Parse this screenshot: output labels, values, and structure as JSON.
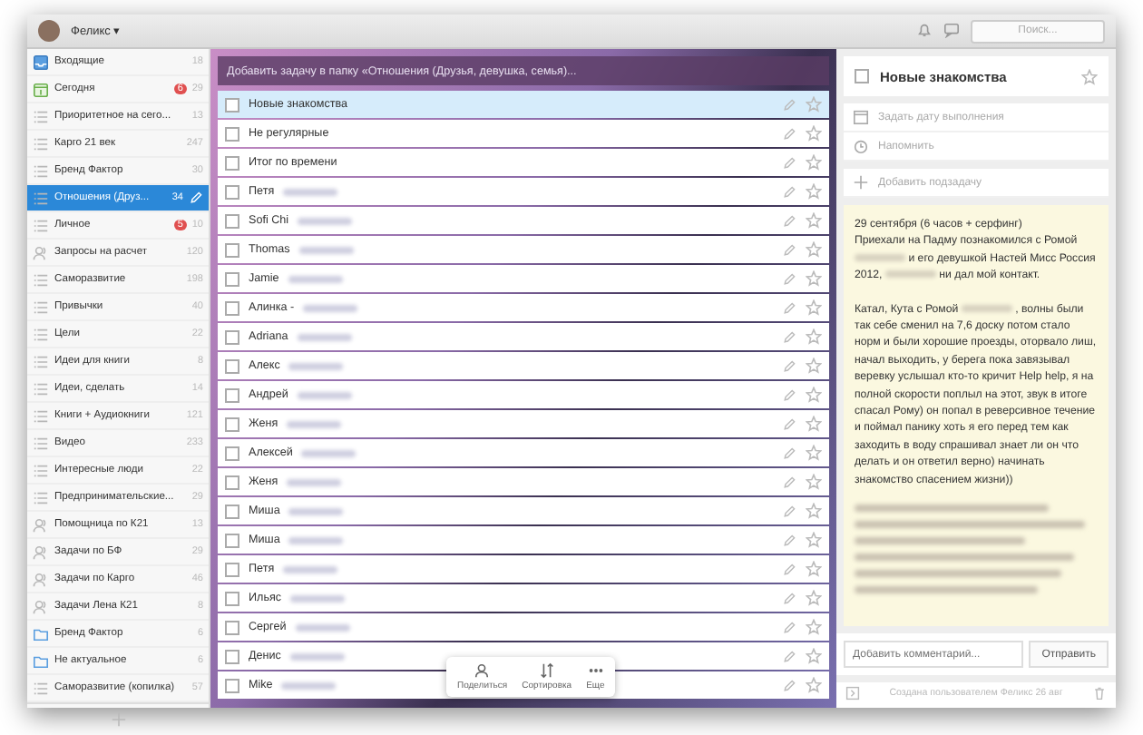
{
  "window": {
    "user": "Феликс ▾",
    "search": {
      "placeholder": "Поиск..."
    }
  },
  "sidebar": {
    "items": [
      {
        "kind": "inbox",
        "label": "Входящие",
        "count": "18",
        "selected": false
      },
      {
        "kind": "today",
        "label": "Сегодня",
        "badge": "6",
        "count": "29",
        "selected": false
      },
      {
        "kind": "list",
        "label": "Приоритетное на сего...",
        "count": "13",
        "selected": false
      },
      {
        "kind": "list",
        "label": "Карго 21 век",
        "count": "247",
        "selected": false
      },
      {
        "kind": "list",
        "label": "Бренд Фактор",
        "count": "30",
        "selected": false
      },
      {
        "kind": "list",
        "label": "Отношения (Друз...",
        "count": "34",
        "selected": true
      },
      {
        "kind": "list",
        "label": "Личное",
        "badge": "5",
        "count": "10",
        "selected": false
      },
      {
        "kind": "shared",
        "label": "Запросы на расчет",
        "count": "120",
        "selected": false
      },
      {
        "kind": "list",
        "label": "Саморазвитие",
        "count": "198",
        "selected": false
      },
      {
        "kind": "list",
        "label": "Привычки",
        "count": "40",
        "selected": false
      },
      {
        "kind": "list",
        "label": "Цели",
        "count": "22",
        "selected": false
      },
      {
        "kind": "list",
        "label": "Идеи для книги",
        "count": "8",
        "selected": false
      },
      {
        "kind": "list",
        "label": "Идеи, сделать",
        "count": "14",
        "selected": false
      },
      {
        "kind": "list",
        "label": "Книги + Аудиокниги",
        "count": "121",
        "selected": false
      },
      {
        "kind": "list",
        "label": "Видео",
        "count": "233",
        "selected": false
      },
      {
        "kind": "list",
        "label": "Интересные люди",
        "count": "22",
        "selected": false
      },
      {
        "kind": "list",
        "label": "Предпринимательские...",
        "count": "29",
        "selected": false
      },
      {
        "kind": "shared",
        "label": "Помощница по К21",
        "count": "13",
        "selected": false
      },
      {
        "kind": "shared",
        "label": "Задачи по БФ",
        "count": "29",
        "selected": false
      },
      {
        "kind": "shared",
        "label": "Задачи по Карго",
        "count": "46",
        "selected": false
      },
      {
        "kind": "shared",
        "label": "Задачи Лена К21",
        "count": "8",
        "selected": false
      },
      {
        "kind": "folder",
        "label": "Бренд Фактор",
        "count": "6",
        "selected": false
      },
      {
        "kind": "folder",
        "label": "Не актуальное",
        "count": "6",
        "selected": false
      },
      {
        "kind": "list",
        "label": "Саморазвитие (копилка)",
        "count": "57",
        "selected": false
      }
    ]
  },
  "tasks": {
    "add_placeholder": "Добавить задачу в папку «Отношения (Друзья, девушка, семья)...",
    "items": [
      {
        "title": "Новые знакомства",
        "selected": true,
        "checked": false,
        "redacted": false
      },
      {
        "title": "Не регулярные",
        "selected": false,
        "checked": false,
        "redacted": false
      },
      {
        "title": "Итог по времени",
        "selected": false,
        "checked": false,
        "redacted": false
      },
      {
        "title": "Петя",
        "selected": false,
        "checked": false,
        "redacted": true
      },
      {
        "title": "Sofi Chi",
        "selected": false,
        "checked": false,
        "redacted": true
      },
      {
        "title": "Thomas",
        "selected": false,
        "checked": false,
        "redacted": true
      },
      {
        "title": "Jamie",
        "selected": false,
        "checked": false,
        "redacted": true
      },
      {
        "title": "Алинка -",
        "selected": false,
        "checked": false,
        "redacted": true
      },
      {
        "title": "Adriana",
        "selected": false,
        "checked": false,
        "redacted": true
      },
      {
        "title": "Алекс",
        "selected": false,
        "checked": false,
        "redacted": true
      },
      {
        "title": "Андрей",
        "selected": false,
        "checked": false,
        "redacted": true
      },
      {
        "title": "Женя",
        "selected": false,
        "checked": false,
        "redacted": true
      },
      {
        "title": "Алексей",
        "selected": false,
        "checked": false,
        "redacted": true
      },
      {
        "title": "Женя",
        "selected": false,
        "checked": false,
        "redacted": true
      },
      {
        "title": "Миша",
        "selected": false,
        "checked": false,
        "redacted": true
      },
      {
        "title": "Миша",
        "selected": false,
        "checked": false,
        "redacted": true
      },
      {
        "title": "Петя",
        "selected": false,
        "checked": false,
        "redacted": true
      },
      {
        "title": "Ильяс",
        "selected": false,
        "checked": false,
        "redacted": true
      },
      {
        "title": "Сергей",
        "selected": false,
        "checked": false,
        "redacted": true
      },
      {
        "title": "Денис",
        "selected": false,
        "checked": false,
        "redacted": true
      },
      {
        "title": "Mike",
        "selected": false,
        "checked": false,
        "redacted": true
      }
    ],
    "toolbar": [
      {
        "kind": "share",
        "label": "Поделиться"
      },
      {
        "kind": "sort",
        "label": "Сортировка"
      },
      {
        "kind": "more",
        "label": "Еще"
      }
    ]
  },
  "detail": {
    "title": "Новые знакомства",
    "checked": false,
    "due": "Задать дату выполнения",
    "remind": "Напомнить",
    "subtask_placeholder": "Добавить подзадачу",
    "note": [
      {
        "kind": "text",
        "gap_before": false,
        "parts": [
          {
            "kind": "text",
            "text": "29 сентября (6 часов + серфинг)"
          }
        ]
      },
      {
        "kind": "text",
        "gap_before": false,
        "parts": [
          {
            "kind": "text",
            "text": "Приехали на Падму познакомился с Ромой"
          },
          {
            "kind": "redacted"
          },
          {
            "kind": "text",
            "text": "и его девушкой Настей Мисс Россия 2012,"
          },
          {
            "kind": "redacted"
          },
          {
            "kind": "text",
            "text": "ни дал мой контакт."
          }
        ]
      },
      {
        "kind": "text",
        "gap_before": true,
        "parts": [
          {
            "kind": "text",
            "text": "Катал, Кута с Ромой"
          },
          {
            "kind": "redacted"
          },
          {
            "kind": "text",
            "text": ", волны были так себе сменил на 7,6 доску потом стало норм и были хорошие проезды, оторвало лиш, начал выходить, у берега пока завязывал веревку услышал кто-то кричит Help help, я на полной скорости поплыл на этот, звук в итоге спасал Рому) он попал в реверсивное течение и поймал панику хоть я его перед тем как заходить в воду спрашивал знает ли он что делать и он ответил верно) начинать знакомство спасением жизни))"
          }
        ]
      },
      {
        "kind": "redacted",
        "gap_before": true
      }
    ],
    "comment_placeholder": "Добавить комментарий...",
    "send": "Отправить",
    "footer": "Создана пользователем Феликс 26 авг"
  }
}
